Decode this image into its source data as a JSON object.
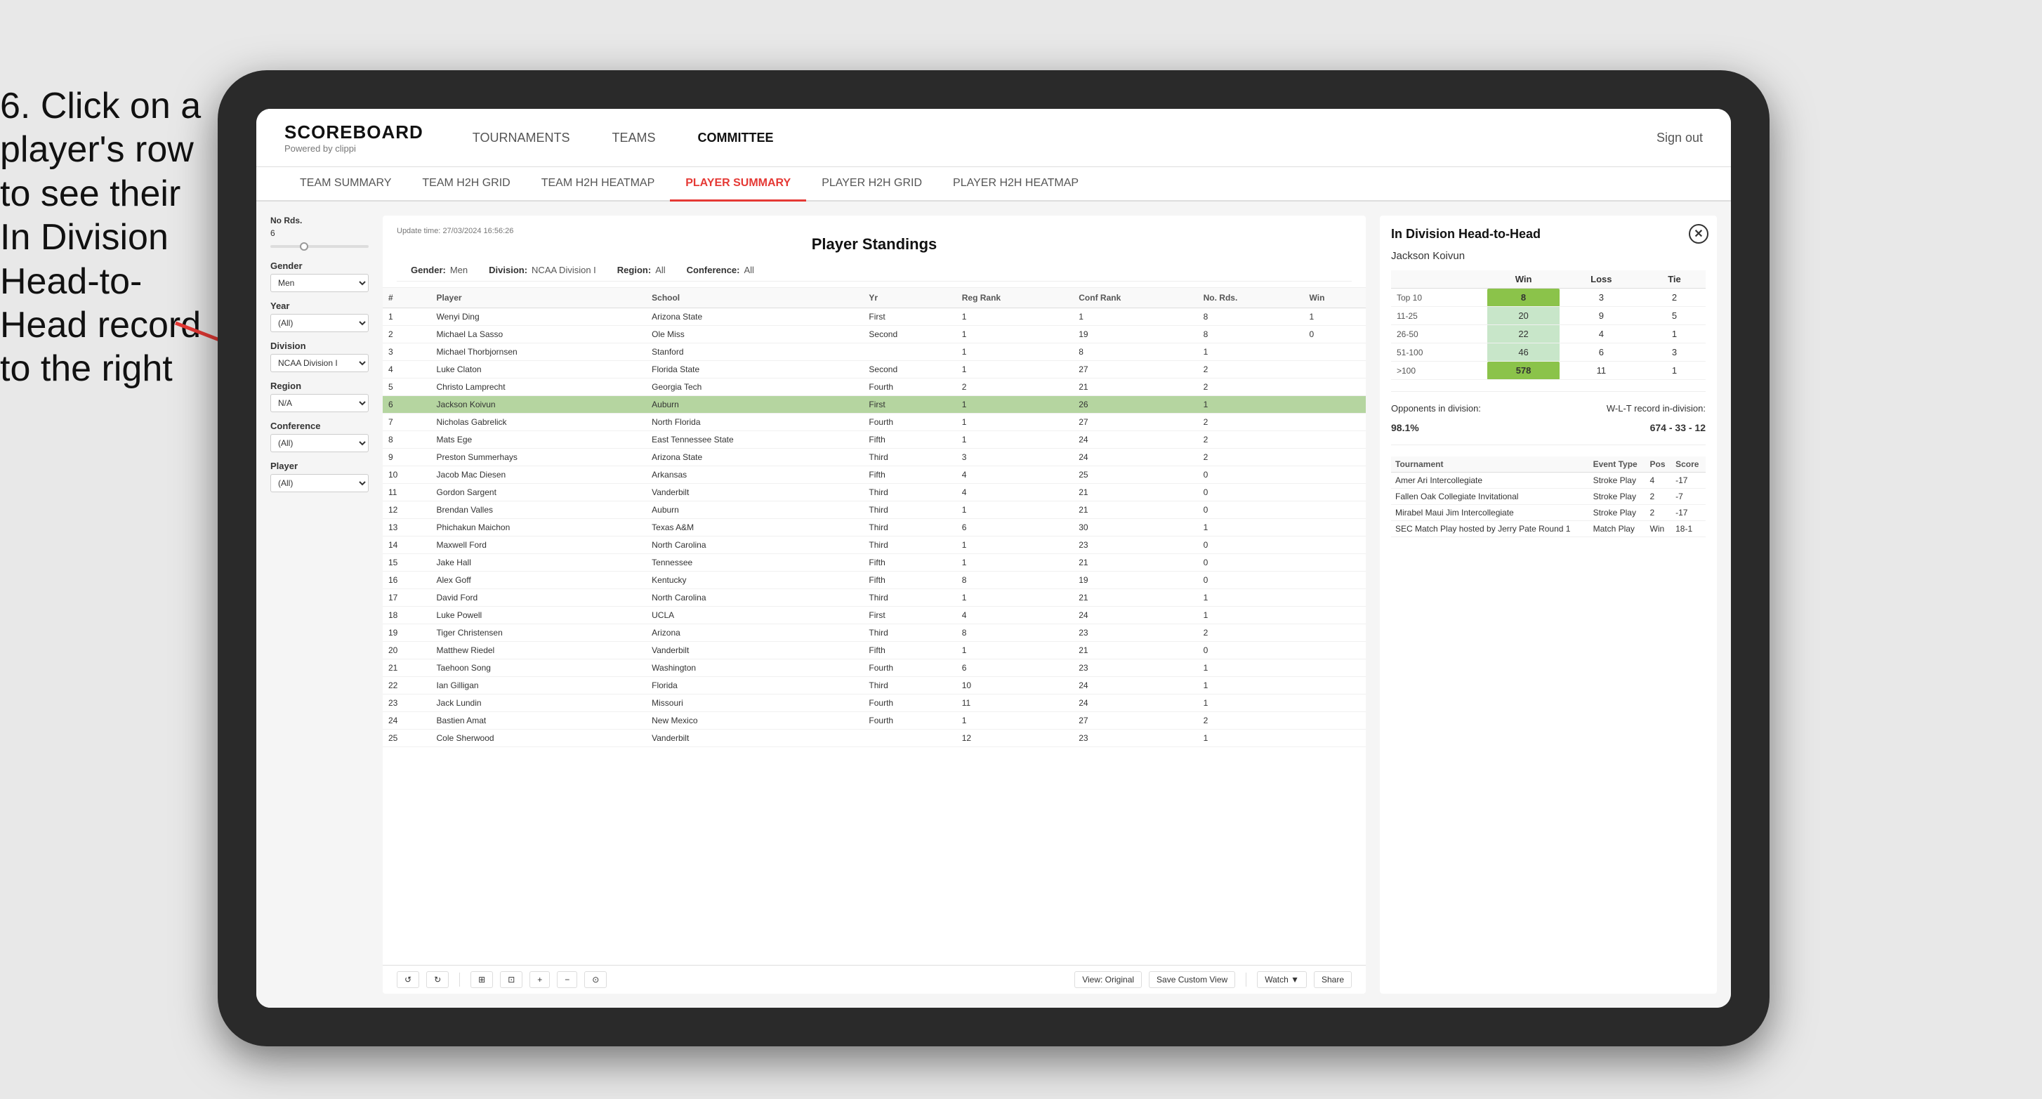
{
  "instruction": {
    "text": "6. Click on a player's row to see their In Division Head-to-Head record to the right"
  },
  "nav": {
    "logo": "SCOREBOARD",
    "powered": "Powered by clippi",
    "items": [
      "TOURNAMENTS",
      "TEAMS",
      "COMMITTEE"
    ],
    "sign_out": "Sign out"
  },
  "sub_nav": {
    "items": [
      "TEAM SUMMARY",
      "TEAM H2H GRID",
      "TEAM H2H HEATMAP",
      "PLAYER SUMMARY",
      "PLAYER H2H GRID",
      "PLAYER H2H HEATMAP"
    ],
    "active": "PLAYER SUMMARY"
  },
  "filters": {
    "no_rds_label": "No Rds.",
    "no_rds_value": "6",
    "gender_label": "Gender",
    "gender_value": "Men",
    "year_label": "Year",
    "year_value": "(All)",
    "division_label": "Division",
    "division_value": "NCAA Division I",
    "region_label": "Region",
    "region_value": "N/A",
    "conference_label": "Conference",
    "conference_value": "(All)",
    "player_label": "Player",
    "player_value": "(All)"
  },
  "standings": {
    "title": "Player Standings",
    "update_time": "Update time:",
    "update_date": "27/03/2024 16:56:26",
    "gender_label": "Gender:",
    "gender_value": "Men",
    "division_label": "Division:",
    "division_value": "NCAA Division I",
    "region_label": "Region:",
    "region_value": "All",
    "conference_label": "Conference:",
    "conference_value": "All",
    "columns": [
      "#",
      "Player",
      "School",
      "Yr",
      "Reg Rank",
      "Conf Rank",
      "No. Rds.",
      "Win"
    ],
    "rows": [
      {
        "rank": "1",
        "player": "Wenyi Ding",
        "school": "Arizona State",
        "yr": "First",
        "reg": "1",
        "conf": "1",
        "rds": "8",
        "win": "1"
      },
      {
        "rank": "2",
        "player": "Michael La Sasso",
        "school": "Ole Miss",
        "yr": "Second",
        "reg": "1",
        "conf": "19",
        "rds": "8",
        "win": "0"
      },
      {
        "rank": "3",
        "player": "Michael Thorbjornsen",
        "school": "Stanford",
        "yr": "",
        "reg": "1",
        "conf": "8",
        "rds": "1",
        "win": ""
      },
      {
        "rank": "4",
        "player": "Luke Claton",
        "school": "Florida State",
        "yr": "Second",
        "reg": "1",
        "conf": "27",
        "rds": "2",
        "win": ""
      },
      {
        "rank": "5",
        "player": "Christo Lamprecht",
        "school": "Georgia Tech",
        "yr": "Fourth",
        "reg": "2",
        "conf": "21",
        "rds": "2",
        "win": ""
      },
      {
        "rank": "6",
        "player": "Jackson Koivun",
        "school": "Auburn",
        "yr": "First",
        "reg": "1",
        "conf": "26",
        "rds": "1",
        "win": "",
        "selected": true
      },
      {
        "rank": "7",
        "player": "Nicholas Gabrelick",
        "school": "North Florida",
        "yr": "Fourth",
        "reg": "1",
        "conf": "27",
        "rds": "2",
        "win": ""
      },
      {
        "rank": "8",
        "player": "Mats Ege",
        "school": "East Tennessee State",
        "yr": "Fifth",
        "reg": "1",
        "conf": "24",
        "rds": "2",
        "win": ""
      },
      {
        "rank": "9",
        "player": "Preston Summerhays",
        "school": "Arizona State",
        "yr": "Third",
        "reg": "3",
        "conf": "24",
        "rds": "2",
        "win": ""
      },
      {
        "rank": "10",
        "player": "Jacob Mac Diesen",
        "school": "Arkansas",
        "yr": "Fifth",
        "reg": "4",
        "conf": "25",
        "rds": "0",
        "win": ""
      },
      {
        "rank": "11",
        "player": "Gordon Sargent",
        "school": "Vanderbilt",
        "yr": "Third",
        "reg": "4",
        "conf": "21",
        "rds": "0",
        "win": ""
      },
      {
        "rank": "12",
        "player": "Brendan Valles",
        "school": "Auburn",
        "yr": "Third",
        "reg": "1",
        "conf": "21",
        "rds": "0",
        "win": ""
      },
      {
        "rank": "13",
        "player": "Phichakun Maichon",
        "school": "Texas A&M",
        "yr": "Third",
        "reg": "6",
        "conf": "30",
        "rds": "1",
        "win": ""
      },
      {
        "rank": "14",
        "player": "Maxwell Ford",
        "school": "North Carolina",
        "yr": "Third",
        "reg": "1",
        "conf": "23",
        "rds": "0",
        "win": ""
      },
      {
        "rank": "15",
        "player": "Jake Hall",
        "school": "Tennessee",
        "yr": "Fifth",
        "reg": "1",
        "conf": "21",
        "rds": "0",
        "win": ""
      },
      {
        "rank": "16",
        "player": "Alex Goff",
        "school": "Kentucky",
        "yr": "Fifth",
        "reg": "8",
        "conf": "19",
        "rds": "0",
        "win": ""
      },
      {
        "rank": "17",
        "player": "David Ford",
        "school": "North Carolina",
        "yr": "Third",
        "reg": "1",
        "conf": "21",
        "rds": "1",
        "win": ""
      },
      {
        "rank": "18",
        "player": "Luke Powell",
        "school": "UCLA",
        "yr": "First",
        "reg": "4",
        "conf": "24",
        "rds": "1",
        "win": ""
      },
      {
        "rank": "19",
        "player": "Tiger Christensen",
        "school": "Arizona",
        "yr": "Third",
        "reg": "8",
        "conf": "23",
        "rds": "2",
        "win": ""
      },
      {
        "rank": "20",
        "player": "Matthew Riedel",
        "school": "Vanderbilt",
        "yr": "Fifth",
        "reg": "1",
        "conf": "21",
        "rds": "0",
        "win": ""
      },
      {
        "rank": "21",
        "player": "Taehoon Song",
        "school": "Washington",
        "yr": "Fourth",
        "reg": "6",
        "conf": "23",
        "rds": "1",
        "win": ""
      },
      {
        "rank": "22",
        "player": "Ian Gilligan",
        "school": "Florida",
        "yr": "Third",
        "reg": "10",
        "conf": "24",
        "rds": "1",
        "win": ""
      },
      {
        "rank": "23",
        "player": "Jack Lundin",
        "school": "Missouri",
        "yr": "Fourth",
        "reg": "11",
        "conf": "24",
        "rds": "1",
        "win": ""
      },
      {
        "rank": "24",
        "player": "Bastien Amat",
        "school": "New Mexico",
        "yr": "Fourth",
        "reg": "1",
        "conf": "27",
        "rds": "2",
        "win": ""
      },
      {
        "rank": "25",
        "player": "Cole Sherwood",
        "school": "Vanderbilt",
        "yr": "",
        "reg": "12",
        "conf": "23",
        "rds": "1",
        "win": ""
      }
    ]
  },
  "h2h": {
    "title": "In Division Head-to-Head",
    "player": "Jackson Koivun",
    "table": {
      "headers": [
        "",
        "Win",
        "Loss",
        "Tie"
      ],
      "rows": [
        {
          "label": "Top 10",
          "win": "8",
          "loss": "3",
          "tie": "2",
          "win_style": "green"
        },
        {
          "label": "11-25",
          "win": "20",
          "loss": "9",
          "tie": "5",
          "win_style": "light-green"
        },
        {
          "label": "26-50",
          "win": "22",
          "loss": "4",
          "tie": "1",
          "win_style": "light-green"
        },
        {
          "label": "51-100",
          "win": "46",
          "loss": "6",
          "tie": "3",
          "win_style": "light-green"
        },
        {
          "label": ">100",
          "win": "578",
          "loss": "11",
          "tie": "1",
          "win_style": "green"
        }
      ]
    },
    "opponents_label": "Opponents in division:",
    "wl_label": "W-L-T record in-division:",
    "pct": "98.1%",
    "record": "674 - 33 - 12",
    "tournament_columns": [
      "Tournament",
      "Event Type",
      "Pos",
      "Score"
    ],
    "tournaments": [
      {
        "name": "Amer Ari Intercollegiate",
        "type": "Stroke Play",
        "pos": "4",
        "score": "-17"
      },
      {
        "name": "Fallen Oak Collegiate Invitational",
        "type": "Stroke Play",
        "pos": "2",
        "score": "-7"
      },
      {
        "name": "Mirabel Maui Jim Intercollegiate",
        "type": "Stroke Play",
        "pos": "2",
        "score": "-17"
      },
      {
        "name": "SEC Match Play hosted by Jerry Pate Round 1",
        "type": "Match Play",
        "pos": "Win",
        "score": "18-1"
      }
    ]
  },
  "toolbar": {
    "undo": "↺",
    "redo": "↻",
    "view_original": "View: Original",
    "save_custom": "Save Custom View",
    "watch": "Watch ▼",
    "share": "Share"
  }
}
